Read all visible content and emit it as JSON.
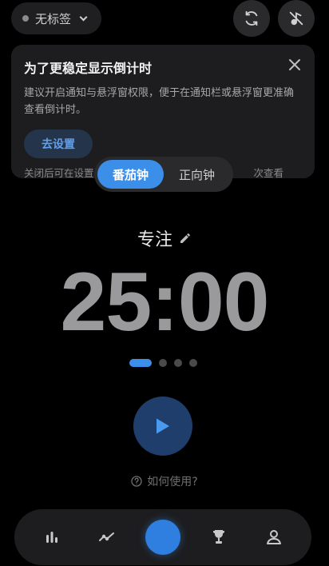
{
  "top_bar": {
    "tag_label": "无标签"
  },
  "notice": {
    "title": "为了更稳定显示倒计时",
    "body": "建议开启通知与悬浮窗权限，便于在通知栏或悬浮窗更准确查看倒计时。",
    "action_label": "去设置",
    "footer_left": "关闭后可在设置",
    "footer_right": "次查看"
  },
  "mode_switch": {
    "items": [
      {
        "label": "番茄钟",
        "active": true
      },
      {
        "label": "正向钟",
        "active": false
      }
    ]
  },
  "timer": {
    "label": "专注",
    "time": "25:00"
  },
  "pager": {
    "count": 4,
    "active_index": 0
  },
  "help": {
    "label": "如何使用?"
  },
  "bottom_nav": {
    "items": [
      "stats-icon",
      "trend-icon",
      "timer-icon",
      "trophy-icon",
      "profile-icon"
    ]
  },
  "colors": {
    "accent": "#3c8fe8",
    "background": "#000000",
    "card": "#1d1d1f"
  }
}
